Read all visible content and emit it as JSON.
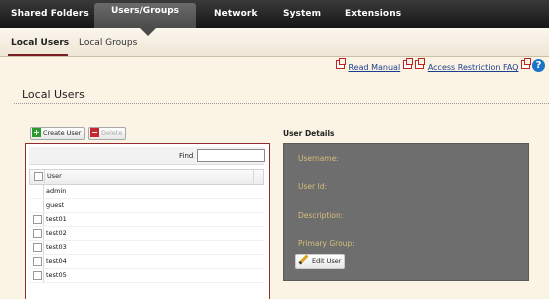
{
  "topnav": {
    "items": [
      "Shared Folders",
      "Users/Groups",
      "Network",
      "System",
      "Extensions"
    ],
    "active": "Users/Groups"
  },
  "subnav": {
    "items": [
      "Local Users",
      "Local Groups"
    ],
    "active": "Local Users"
  },
  "help": {
    "manual_label": "Read Manual",
    "faq_label": "Access Restriction FAQ",
    "help_icon": "?"
  },
  "page": {
    "title": "Local Users"
  },
  "toolbar": {
    "create_label": "Create User",
    "delete_label": "Delete"
  },
  "grid": {
    "find_label": "Find",
    "find_value": "",
    "column_header": "User",
    "rows": [
      "admin",
      "guest",
      "test01",
      "test02",
      "test03",
      "test04",
      "test05"
    ],
    "rows_with_checkbox": [
      false,
      false,
      true,
      true,
      true,
      true,
      true
    ]
  },
  "details": {
    "title": "User Details",
    "username_label": "Username:",
    "userid_label": "User Id:",
    "description_label": "Description:",
    "primary_group_label": "Primary Group:",
    "edit_label": "Edit User"
  }
}
